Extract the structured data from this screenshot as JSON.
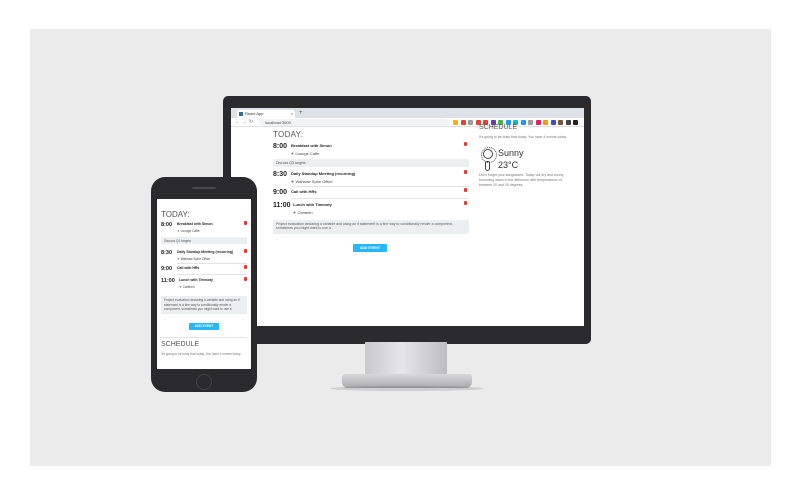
{
  "browser": {
    "tab_title": "React App",
    "tab_close": "×",
    "new_tab": "+",
    "url": "localhost:3000",
    "back": "←",
    "forward": "→",
    "reload": "↻",
    "ext_colors": [
      "#f4b400",
      "#db4437",
      "#9e9e9e",
      "#db4437",
      "#db4437",
      "#673ab7",
      "#4caf50",
      "#2196f3",
      "#00bcd4",
      "#2196f3",
      "#9e9e9e",
      "#e91e63",
      "#ff9800",
      "#3f51b5",
      "#795548",
      "#424242",
      "#212121"
    ]
  },
  "app": {
    "today_label": "TODAY:",
    "events": [
      {
        "time": "8:00",
        "title": "Breakfast with Simon",
        "location": "Lounge Caffe"
      },
      {
        "time": "8:30",
        "title": "Daily Standup Meeting (recurring)",
        "location": "Wahsaw Spire Office"
      },
      {
        "time": "9:00",
        "title": "Call with HRs",
        "location": ""
      },
      {
        "time": "11:00",
        "title": "Lunch with Timmoty",
        "location": "Canteen"
      }
    ],
    "note_discuss": "Discuss Q3 targets",
    "note_project": "Project evaluation declaring a variable and using an if statement is a fine way to conditionally render a component, sometimes you might want to use a",
    "add_event_label": "ADD EVENT",
    "schedule_title": "SCHEDULE",
    "schedule_text": "It's going to be busy that today. You have 4 events today.",
    "weather_condition": "Sunny",
    "weather_temp": "23°C",
    "weather_text": "Don't forget your sunglasses. Today will dry and sunny, becoming warm in the afternoon with temperatures of between 20 and 25 degrees."
  },
  "phone_app": {
    "schedule_text": "It's going to be busy that today. You have 4 events today."
  },
  "colors": {
    "accent": "#29b6f6",
    "delete": "#e53935",
    "note_bg": "#eceff1"
  }
}
